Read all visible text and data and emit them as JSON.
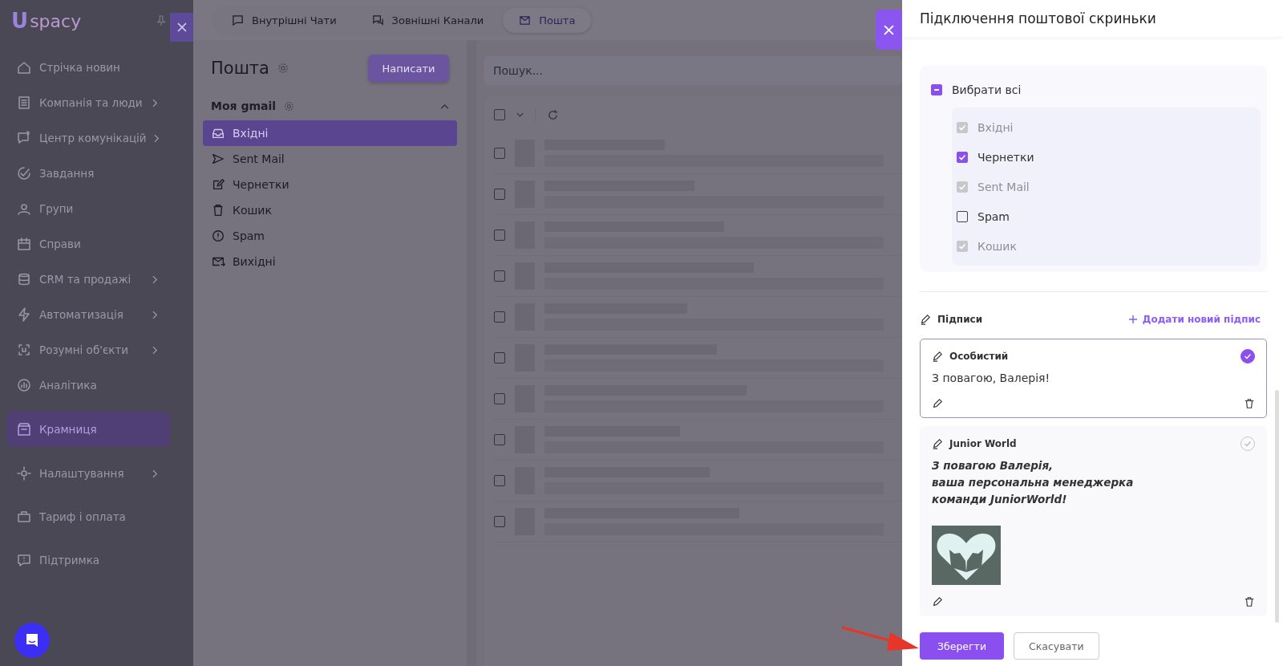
{
  "logo": {
    "mark": "U",
    "text": "spacy"
  },
  "nav": [
    {
      "label": "Стрічка новин",
      "submenu": false,
      "selected": false
    },
    {
      "label": "Компанія та люди",
      "submenu": true,
      "selected": false
    },
    {
      "label": "Центр комунікацій",
      "submenu": true,
      "selected": false
    },
    {
      "label": "Завдання",
      "submenu": false,
      "selected": false
    },
    {
      "label": "Групи",
      "submenu": false,
      "selected": false
    },
    {
      "label": "Справи",
      "submenu": false,
      "selected": false
    },
    {
      "label": "CRM та продажі",
      "submenu": true,
      "selected": false
    },
    {
      "label": "Автоматизація",
      "submenu": true,
      "selected": false
    },
    {
      "label": "Розумні об'єкти",
      "submenu": true,
      "selected": false
    },
    {
      "label": "Аналітика",
      "submenu": false,
      "selected": false
    },
    {
      "label": "Крамниця",
      "submenu": false,
      "selected": true
    },
    {
      "label": "Налаштування",
      "submenu": true,
      "selected": false
    },
    {
      "label": "Тариф і оплата",
      "submenu": false,
      "selected": false
    },
    {
      "label": "Підтримка",
      "submenu": false,
      "selected": false
    }
  ],
  "tabs": [
    {
      "label": "Внутрішні Чати",
      "selected": false
    },
    {
      "label": "Зовнішні Канали",
      "selected": false
    },
    {
      "label": "Пошта",
      "selected": true
    }
  ],
  "mail": {
    "title": "Пошта",
    "compose": "Написати",
    "account": "Моя gmail",
    "expanded": true,
    "folders": [
      {
        "label": "Вхідні",
        "selected": true
      },
      {
        "label": "Sent Mail",
        "selected": false
      },
      {
        "label": "Чернетки",
        "selected": false
      },
      {
        "label": "Кошик",
        "selected": false
      },
      {
        "label": "Spam",
        "selected": false
      },
      {
        "label": "Вихідні",
        "selected": false
      }
    ]
  },
  "search": {
    "placeholder": "Пошук..."
  },
  "list_select_all": {
    "checked": false
  },
  "messages": [
    {
      "checked": false
    },
    {
      "checked": false
    },
    {
      "checked": false
    },
    {
      "checked": false
    },
    {
      "checked": false
    },
    {
      "checked": false
    },
    {
      "checked": false
    },
    {
      "checked": false
    },
    {
      "checked": false
    },
    {
      "checked": false
    }
  ],
  "drawer": {
    "title": "Підключення поштової скриньки",
    "select_all": {
      "label": "Вибрати всі",
      "indeterminate": true
    },
    "folders": [
      {
        "label": "Вхідні",
        "checked": true,
        "disabled": true
      },
      {
        "label": "Чернетки",
        "checked": true,
        "disabled": false
      },
      {
        "label": "Sent Mail",
        "checked": true,
        "disabled": true
      },
      {
        "label": "Spam",
        "checked": false,
        "disabled": false
      },
      {
        "label": "Кошик",
        "checked": true,
        "disabled": true
      }
    ],
    "signatures_title": "Підписи",
    "add_signature": "Додати новий підпис",
    "signatures": [
      {
        "name": "Особистий",
        "selected": true,
        "kind": "plain",
        "lines": [
          "З повагою, Валерія!"
        ]
      },
      {
        "name": "Junior World",
        "selected": false,
        "kind": "styled",
        "lines": [
          "З повагою Валерія,",
          "ваша персональна менеджерка",
          "команди JuniorWorld!"
        ]
      }
    ],
    "buttons": [
      {
        "label": "Зберегти",
        "kind": "primary"
      },
      {
        "label": "Скасувати",
        "kind": "secondary"
      }
    ]
  }
}
